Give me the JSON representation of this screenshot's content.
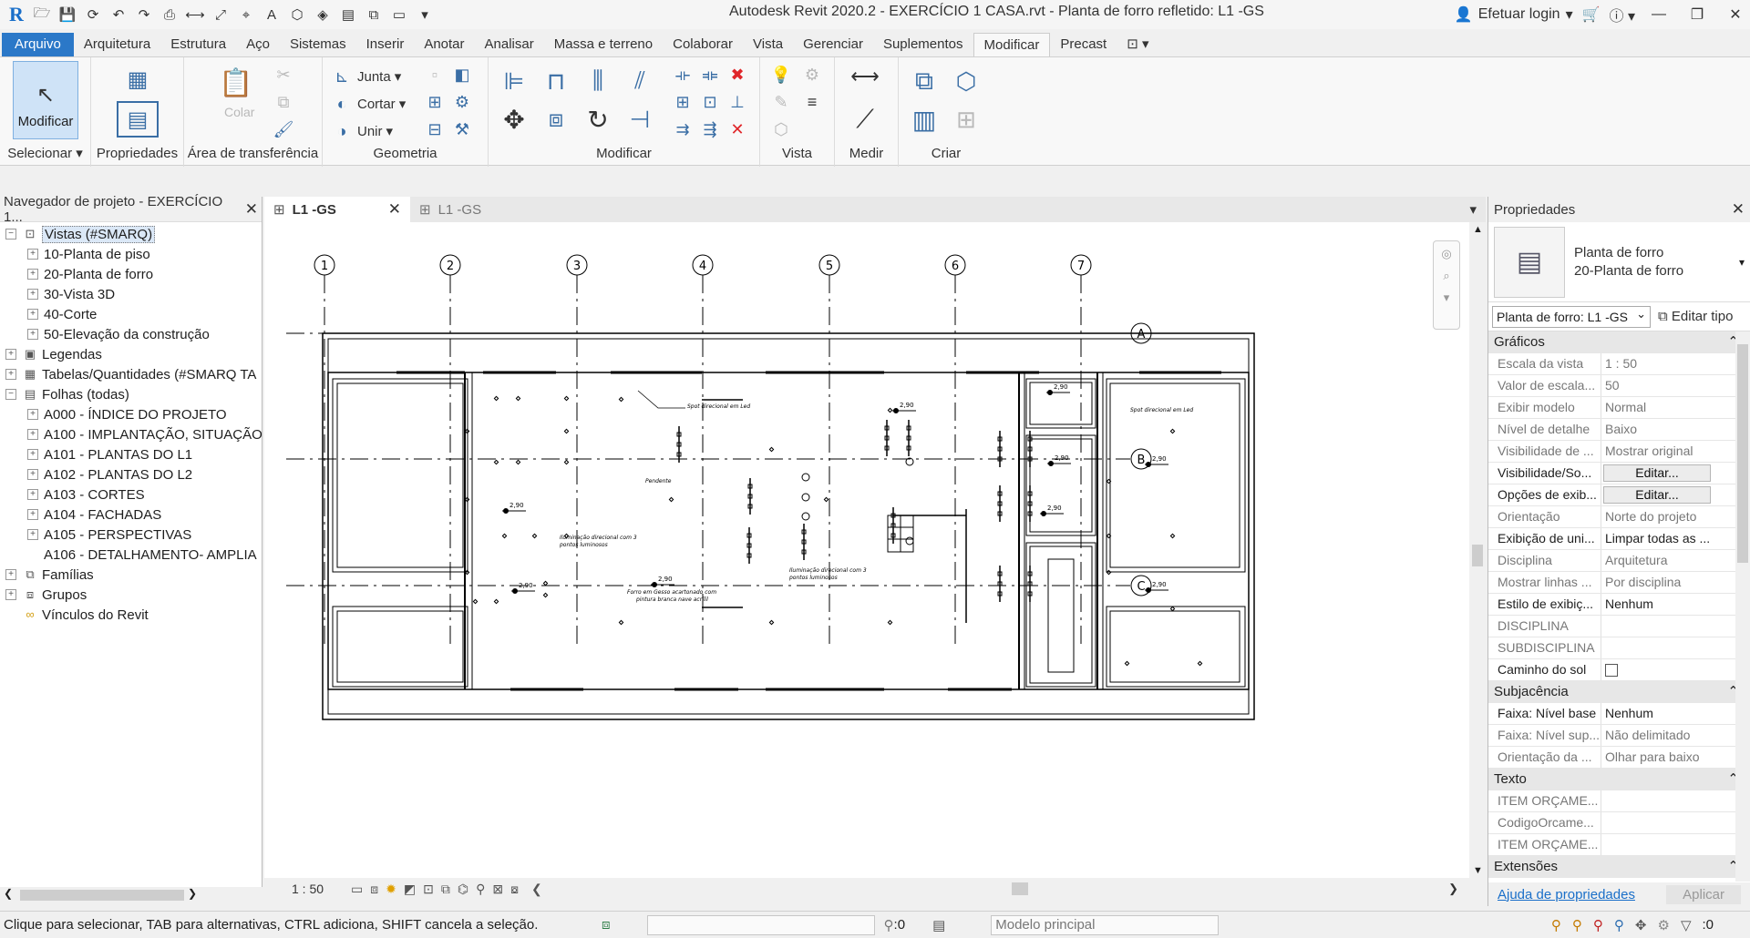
{
  "window": {
    "title": "Autodesk Revit 2020.2 - EXERCÍCIO 1 CASA.rvt - Planta de forro refletido: L1 -GS",
    "login": "Efetuar login"
  },
  "ribbon_tabs": [
    "Arquivo",
    "Arquitetura",
    "Estrutura",
    "Aço",
    "Sistemas",
    "Inserir",
    "Anotar",
    "Analisar",
    "Massa e terreno",
    "Colaborar",
    "Vista",
    "Gerenciar",
    "Suplementos",
    "Modificar",
    "Precast"
  ],
  "ribbon": {
    "modify_label": "Modificar",
    "select_label": "Selecionar ▾",
    "properties_label": "Propriedades",
    "clipboard_label": "Área de transferência",
    "paste_label": "Colar",
    "geometry_label": "Geometria",
    "join_label": "Junta",
    "cut_label": "Cortar",
    "unite_label": "Unir",
    "modify_panel_label": "Modificar",
    "view_label": "Vista",
    "measure_label": "Medir",
    "create_label": "Criar"
  },
  "browser": {
    "title": "Navegador de projeto - EXERCÍCIO 1...",
    "items": [
      {
        "label": "Vistas (#SMARQ)",
        "level": 0,
        "exp": "−",
        "icon": "views-icon",
        "selected": true
      },
      {
        "label": "10-Planta de piso",
        "level": 1,
        "exp": "+"
      },
      {
        "label": "20-Planta de forro",
        "level": 1,
        "exp": "+"
      },
      {
        "label": "30-Vista 3D",
        "level": 1,
        "exp": "+"
      },
      {
        "label": "40-Corte",
        "level": 1,
        "exp": "+"
      },
      {
        "label": "50-Elevação da construção",
        "level": 1,
        "exp": "+"
      },
      {
        "label": "Legendas",
        "level": 0,
        "exp": "+",
        "icon": "legends-icon"
      },
      {
        "label": "Tabelas/Quantidades (#SMARQ TA",
        "level": 0,
        "exp": "+",
        "icon": "schedules-icon"
      },
      {
        "label": "Folhas (todas)",
        "level": 0,
        "exp": "−",
        "icon": "sheets-icon"
      },
      {
        "label": "A000 - ÍNDICE DO PROJETO",
        "level": 1,
        "exp": "+"
      },
      {
        "label": "A100 - IMPLANTAÇÃO, SITUAÇÃO",
        "level": 1,
        "exp": "+"
      },
      {
        "label": "A101 - PLANTAS DO L1",
        "level": 1,
        "exp": "+"
      },
      {
        "label": "A102 - PLANTAS DO L2",
        "level": 1,
        "exp": "+"
      },
      {
        "label": "A103 - CORTES",
        "level": 1,
        "exp": "+"
      },
      {
        "label": "A104 - FACHADAS",
        "level": 1,
        "exp": "+"
      },
      {
        "label": "A105 - PERSPECTIVAS",
        "level": 1,
        "exp": "+"
      },
      {
        "label": "A106 - DETALHAMENTO- AMPLIA",
        "level": 1,
        "exp": ""
      },
      {
        "label": "Famílias",
        "level": 0,
        "exp": "+",
        "icon": "families-icon"
      },
      {
        "label": "Grupos",
        "level": 0,
        "exp": "+",
        "icon": "groups-icon"
      },
      {
        "label": "Vínculos do Revit",
        "level": 0,
        "exp": "",
        "icon": "links-icon"
      }
    ]
  },
  "view_tabs": [
    {
      "label": "L1 -GS",
      "active": true
    },
    {
      "label": "L1 -GS",
      "active": false
    }
  ],
  "drawing": {
    "grid_columns": [
      "1",
      "2",
      "3",
      "4",
      "5",
      "6",
      "7"
    ],
    "grid_rows": [
      "A",
      "B",
      "C"
    ],
    "annotations": {
      "spot_led": "Spot direcional em Led",
      "spot_led_2": "Spot direcional em Led",
      "pendente": "Pendente",
      "ilum_1a": "Iluminação direcional com 3",
      "ilum_1b": "pontos luminosos",
      "ilum_2a": "Iluminação direcional com 3",
      "ilum_2b": "pontos luminosos",
      "forro_a": "Forro em Gesso acartonado com",
      "forro_b": "pintura branca nave acrílil",
      "h": "2,90"
    }
  },
  "viewbar": {
    "scale": "1 : 50"
  },
  "properties": {
    "title": "Propriedades",
    "type_line1": "Planta de forro",
    "type_line2": "20-Planta de forro",
    "instance": "Planta de forro: L1 -GS",
    "edit_type": "Editar tipo",
    "groups": [
      {
        "name": "Gráficos",
        "rows": [
          {
            "k": "Escala da vista",
            "v": "1 : 50",
            "active": false
          },
          {
            "k": "Valor de escala...",
            "v": "50",
            "active": false
          },
          {
            "k": "Exibir modelo",
            "v": "Normal",
            "active": false
          },
          {
            "k": "Nível de detalhe",
            "v": "Baixo",
            "active": false
          },
          {
            "k": "Visibilidade de ...",
            "v": "Mostrar original",
            "active": false
          },
          {
            "k": "Visibilidade/So...",
            "v": "Editar...",
            "btn": true,
            "active": true
          },
          {
            "k": "Opções de exib...",
            "v": "Editar...",
            "btn": true,
            "active": true
          },
          {
            "k": "Orientação",
            "v": "Norte do projeto",
            "active": false
          },
          {
            "k": "Exibição de uni...",
            "v": "Limpar todas as ...",
            "active": true
          },
          {
            "k": "Disciplina",
            "v": "Arquitetura",
            "active": false
          },
          {
            "k": "Mostrar linhas ...",
            "v": "Por disciplina",
            "active": false
          },
          {
            "k": "Estilo de exibiç...",
            "v": "Nenhum",
            "active": true
          },
          {
            "k": "DISCIPLINA",
            "v": "",
            "active": false
          },
          {
            "k": "SUBDISCIPLINA",
            "v": "",
            "active": false
          },
          {
            "k": "Caminho do sol",
            "v": "",
            "chk": true,
            "active": true
          }
        ]
      },
      {
        "name": "Subjacência",
        "rows": [
          {
            "k": "Faixa: Nível base",
            "v": "Nenhum",
            "active": true
          },
          {
            "k": "Faixa: Nível sup...",
            "v": "Não delimitado",
            "active": false
          },
          {
            "k": "Orientação da ...",
            "v": "Olhar para baixo",
            "active": false
          }
        ]
      },
      {
        "name": "Texto",
        "rows": [
          {
            "k": "ITEM ORÇAME...",
            "v": "",
            "active": false
          },
          {
            "k": "CodigoOrcame...",
            "v": "",
            "active": false
          },
          {
            "k": "ITEM ORÇAME...",
            "v": "",
            "active": false
          }
        ]
      },
      {
        "name": "Extensões",
        "rows": []
      }
    ],
    "help": "Ajuda de propriedades",
    "apply": "Aplicar"
  },
  "status": {
    "message": "Clique para selecionar, TAB para alternativas, CTRL adiciona, SHIFT cancela a seleção.",
    "worksets": ":0",
    "model": "Modelo principal",
    "filter": ":0"
  }
}
